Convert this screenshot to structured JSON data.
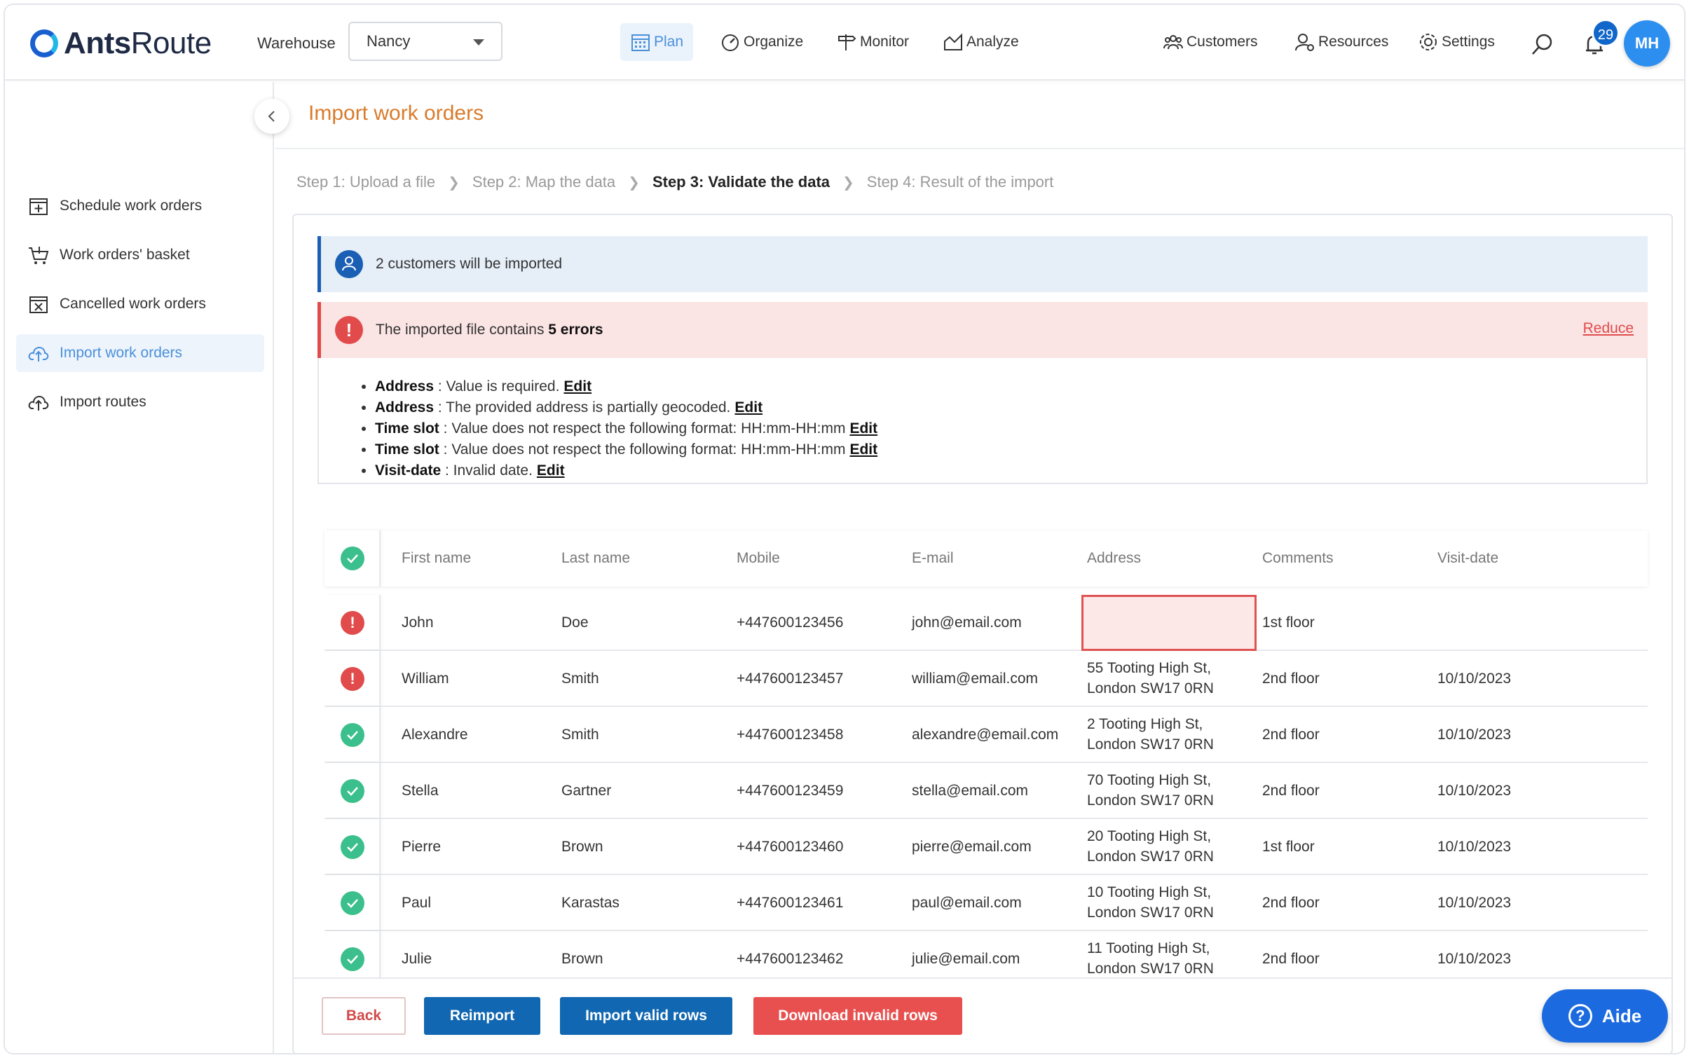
{
  "app": {
    "logo_bold": "Ants",
    "logo_light": "Route"
  },
  "header": {
    "warehouse_label": "Warehouse",
    "warehouse_value": "Nancy",
    "nav": {
      "plan": "Plan",
      "organize": "Organize",
      "monitor": "Monitor",
      "analyze": "Analyze",
      "customers": "Customers",
      "resources": "Resources",
      "settings": "Settings"
    },
    "notifications_count": "29",
    "avatar_initials": "MH"
  },
  "sidebar": {
    "items": [
      {
        "label": "Schedule work orders"
      },
      {
        "label": "Work orders' basket"
      },
      {
        "label": "Cancelled work orders"
      },
      {
        "label": "Import work orders"
      },
      {
        "label": "Import routes"
      }
    ]
  },
  "page": {
    "title": "Import work orders",
    "steps": [
      "Step 1: Upload a file",
      "Step 2: Map the data",
      "Step 3: Validate the data",
      "Step 4: Result of the import"
    ]
  },
  "info_banner": {
    "text": "2 customers will be imported"
  },
  "error_banner": {
    "text": "The imported file contains ",
    "count_text": "5 errors",
    "reduce_label": "Reduce"
  },
  "errors": [
    {
      "field": "Address",
      "message": " : Value is required.",
      "edit": "Edit"
    },
    {
      "field": "Address",
      "message": " : The provided address is partially geocoded.",
      "edit": "Edit"
    },
    {
      "field": "Time slot",
      "message": " : Value does not respect the following format: HH:mm-HH:mm",
      "edit": "Edit"
    },
    {
      "field": "Time slot",
      "message": " : Value does not respect the following format: HH:mm-HH:mm",
      "edit": "Edit"
    },
    {
      "field": "Visit-date",
      "message": " : Invalid date.",
      "edit": "Edit"
    }
  ],
  "table": {
    "columns": {
      "first_name": "First name",
      "last_name": "Last name",
      "mobile": "Mobile",
      "email": "E-mail",
      "address": "Address",
      "comments": "Comments",
      "visit_date": "Visit-date"
    },
    "rows": [
      {
        "status": "error",
        "first": "John",
        "last": "Doe",
        "mobile": "+447600123456",
        "email": "john@email.com",
        "addr1": "",
        "addr2": "",
        "comments": "1st floor",
        "date": ""
      },
      {
        "status": "error",
        "first": "William",
        "last": "Smith",
        "mobile": "+447600123457",
        "email": "william@email.com",
        "addr1": "55 Tooting High St,",
        "addr2": "London SW17 0RN",
        "comments": "2nd floor",
        "date": "10/10/2023"
      },
      {
        "status": "ok",
        "first": "Alexandre",
        "last": "Smith",
        "mobile": "+447600123458",
        "email": "alexandre@email.com",
        "addr1": "2 Tooting High St,",
        "addr2": "London SW17 0RN",
        "comments": "2nd floor",
        "date": "10/10/2023"
      },
      {
        "status": "ok",
        "first": "Stella",
        "last": "Gartner",
        "mobile": "+447600123459",
        "email": "stella@email.com",
        "addr1": "70 Tooting High St,",
        "addr2": "London SW17 0RN",
        "comments": "2nd floor",
        "date": "10/10/2023"
      },
      {
        "status": "ok",
        "first": "Pierre",
        "last": "Brown",
        "mobile": "+447600123460",
        "email": "pierre@email.com",
        "addr1": "20 Tooting High St,",
        "addr2": "London SW17 0RN",
        "comments": "1st floor",
        "date": "10/10/2023"
      },
      {
        "status": "ok",
        "first": "Paul",
        "last": "Karastas",
        "mobile": "+447600123461",
        "email": "paul@email.com",
        "addr1": "10 Tooting High St,",
        "addr2": "London SW17 0RN",
        "comments": "2nd floor",
        "date": "10/10/2023"
      },
      {
        "status": "ok",
        "first": "Julie",
        "last": "Brown",
        "mobile": "+447600123462",
        "email": "julie@email.com",
        "addr1": "11 Tooting High St,",
        "addr2": "London SW17 0RN",
        "comments": "2nd floor",
        "date": "10/10/2023"
      }
    ]
  },
  "footer": {
    "back": "Back",
    "reimport": "Reimport",
    "import_valid": "Import valid rows",
    "download_invalid": "Download invalid rows"
  },
  "help": {
    "label": "Aide"
  },
  "colors": {
    "accent": "#1167b1",
    "error": "#e14b4b",
    "success": "#3bbf8c",
    "title": "#d97b2c"
  }
}
